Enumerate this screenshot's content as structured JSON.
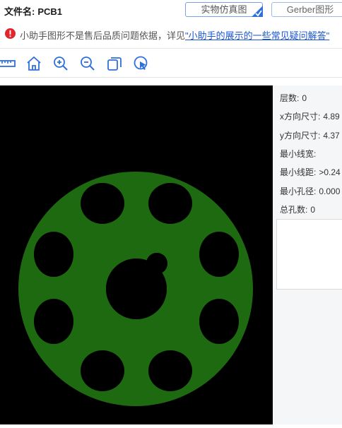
{
  "header": {
    "file_label": "文件名:",
    "file_name": "PCB1",
    "tabs": [
      {
        "label": "实物仿真图",
        "active": true
      },
      {
        "label": "Gerber图形",
        "active": false
      }
    ]
  },
  "notice": {
    "icon": "exclamation-circle-icon",
    "text": "小助手图形不是售后品质问题依据，详见",
    "link_text": "\"小助手的展示的一些常见疑问解答\"",
    "colors": {
      "warning": "#e0262b",
      "link": "#1a56d6"
    }
  },
  "toolbar": {
    "tools": [
      {
        "name": "ruler-icon"
      },
      {
        "name": "home-icon"
      },
      {
        "name": "zoom-in-icon"
      },
      {
        "name": "zoom-out-icon"
      },
      {
        "name": "layers-icon"
      },
      {
        "name": "select-cursor-icon"
      }
    ],
    "icon_color": "#2f6fdc"
  },
  "board": {
    "background": "#000000",
    "fill_color": "#1e6a10"
  },
  "info": {
    "layers": {
      "label": "层数:",
      "value": "0"
    },
    "x_size": {
      "label": "x方向尺寸:",
      "value": "4.89"
    },
    "y_size": {
      "label": "y方向尺寸:",
      "value": "4.37"
    },
    "min_width": {
      "label": "最小线宽:",
      "value": ""
    },
    "min_spacing": {
      "label": "最小线距:",
      "value": ">0.24"
    },
    "min_hole": {
      "label": "最小孔径:",
      "value": "0.000"
    },
    "total_holes": {
      "label": "总孔数:",
      "value": "0"
    }
  }
}
